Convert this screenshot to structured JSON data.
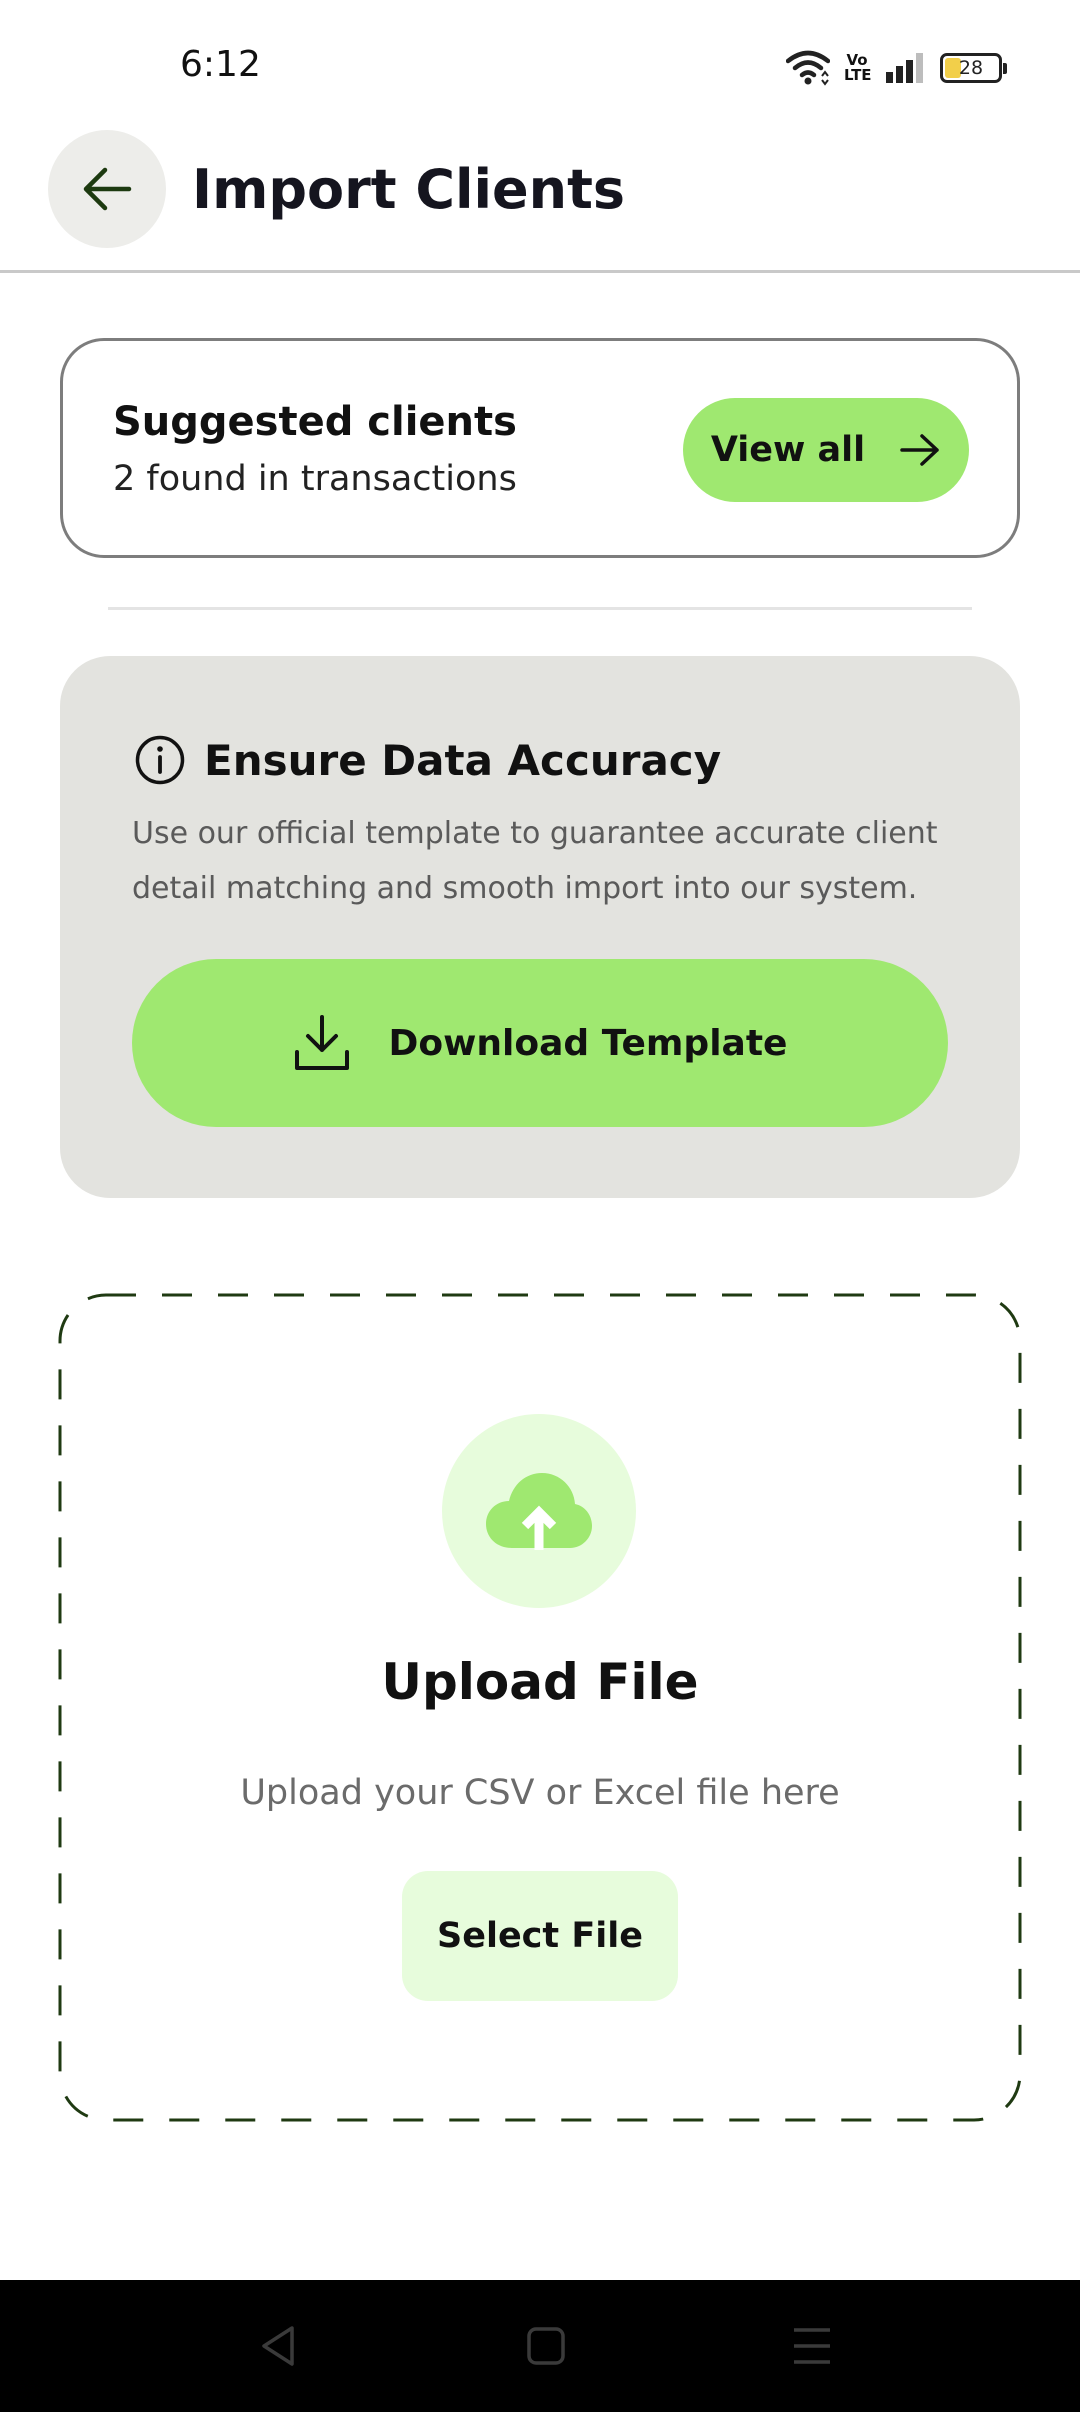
{
  "status_bar": {
    "time": "6:12",
    "network_label": "Vo\nLTE",
    "battery_level": "28",
    "icons": [
      "wifi-icon",
      "volte-icon",
      "signal-icon",
      "battery-icon"
    ]
  },
  "header": {
    "back_icon": "arrow-left-icon",
    "title": "Import Clients"
  },
  "suggested": {
    "title": "Suggested clients",
    "subtitle": "2 found in transactions",
    "button_label": "View all",
    "button_icon": "arrow-right-icon"
  },
  "accuracy": {
    "icon": "info-icon",
    "title": "Ensure Data Accuracy",
    "description": "Use our official template to guarantee accurate client detail matching and smooth import into our system.",
    "button_label": "Download Template",
    "button_icon": "download-icon"
  },
  "upload": {
    "icon": "cloud-upload-icon",
    "title": "Upload File",
    "subtitle": "Upload your CSV or Excel file here",
    "button_label": "Select File"
  },
  "nav_bar": {
    "icons": [
      "back-triangle-icon",
      "home-square-icon",
      "menu-icon"
    ]
  },
  "colors": {
    "accent_green": "#9fe870",
    "light_green": "#e7fcdc",
    "card_gray": "#e3e3df",
    "dashed_border": "#1f3a12"
  }
}
